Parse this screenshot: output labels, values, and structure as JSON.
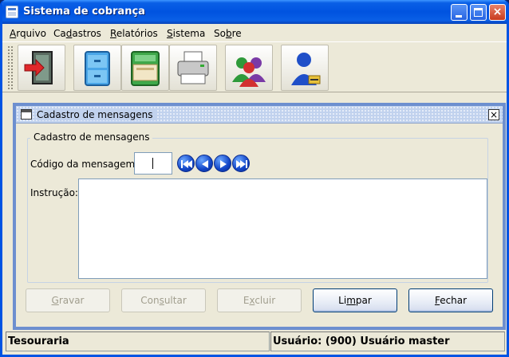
{
  "window": {
    "title": "Sistema de cobrança"
  },
  "menu": [
    {
      "underline": "A",
      "rest": "rquivo"
    },
    {
      "lead": "Ca",
      "underline": "d",
      "rest": "astros"
    },
    {
      "underline": "R",
      "rest": "elatórios"
    },
    {
      "underline": "S",
      "rest": "istema"
    },
    {
      "lead": "So",
      "underline": "b",
      "rest": "re"
    }
  ],
  "toolbar": {
    "icons": [
      "exit-door-icon",
      "file-cabinet-icon",
      "open-folder-icon",
      "printer-icon",
      "users-group-icon",
      "user-admin-icon"
    ]
  },
  "form": {
    "title": "Cadastro de mensagens",
    "group_title": "Cadastro de mensagens",
    "codigo_label": "Código da mensagem:",
    "codigo_value": "",
    "instrucao_label": "Instrução:",
    "instrucao_value": "",
    "nav_icons": [
      "first-record-icon",
      "previous-record-icon",
      "next-record-icon",
      "last-record-icon"
    ],
    "buttons": [
      {
        "key": "gravar",
        "lead": "",
        "underline": "G",
        "rest": "ravar",
        "enabled": false
      },
      {
        "key": "consultar",
        "lead": "Con",
        "underline": "s",
        "rest": "ultar",
        "enabled": false
      },
      {
        "key": "excluir",
        "lead": "E",
        "underline": "x",
        "rest": "cluir",
        "enabled": false
      },
      {
        "key": "limpar",
        "lead": "Li",
        "underline": "m",
        "rest": "par",
        "enabled": true
      },
      {
        "key": "fechar",
        "lead": "",
        "underline": "F",
        "rest": "echar",
        "enabled": true
      }
    ]
  },
  "status": {
    "left": "Tesouraria",
    "right": "Usuário: (900) Usuário master"
  }
}
